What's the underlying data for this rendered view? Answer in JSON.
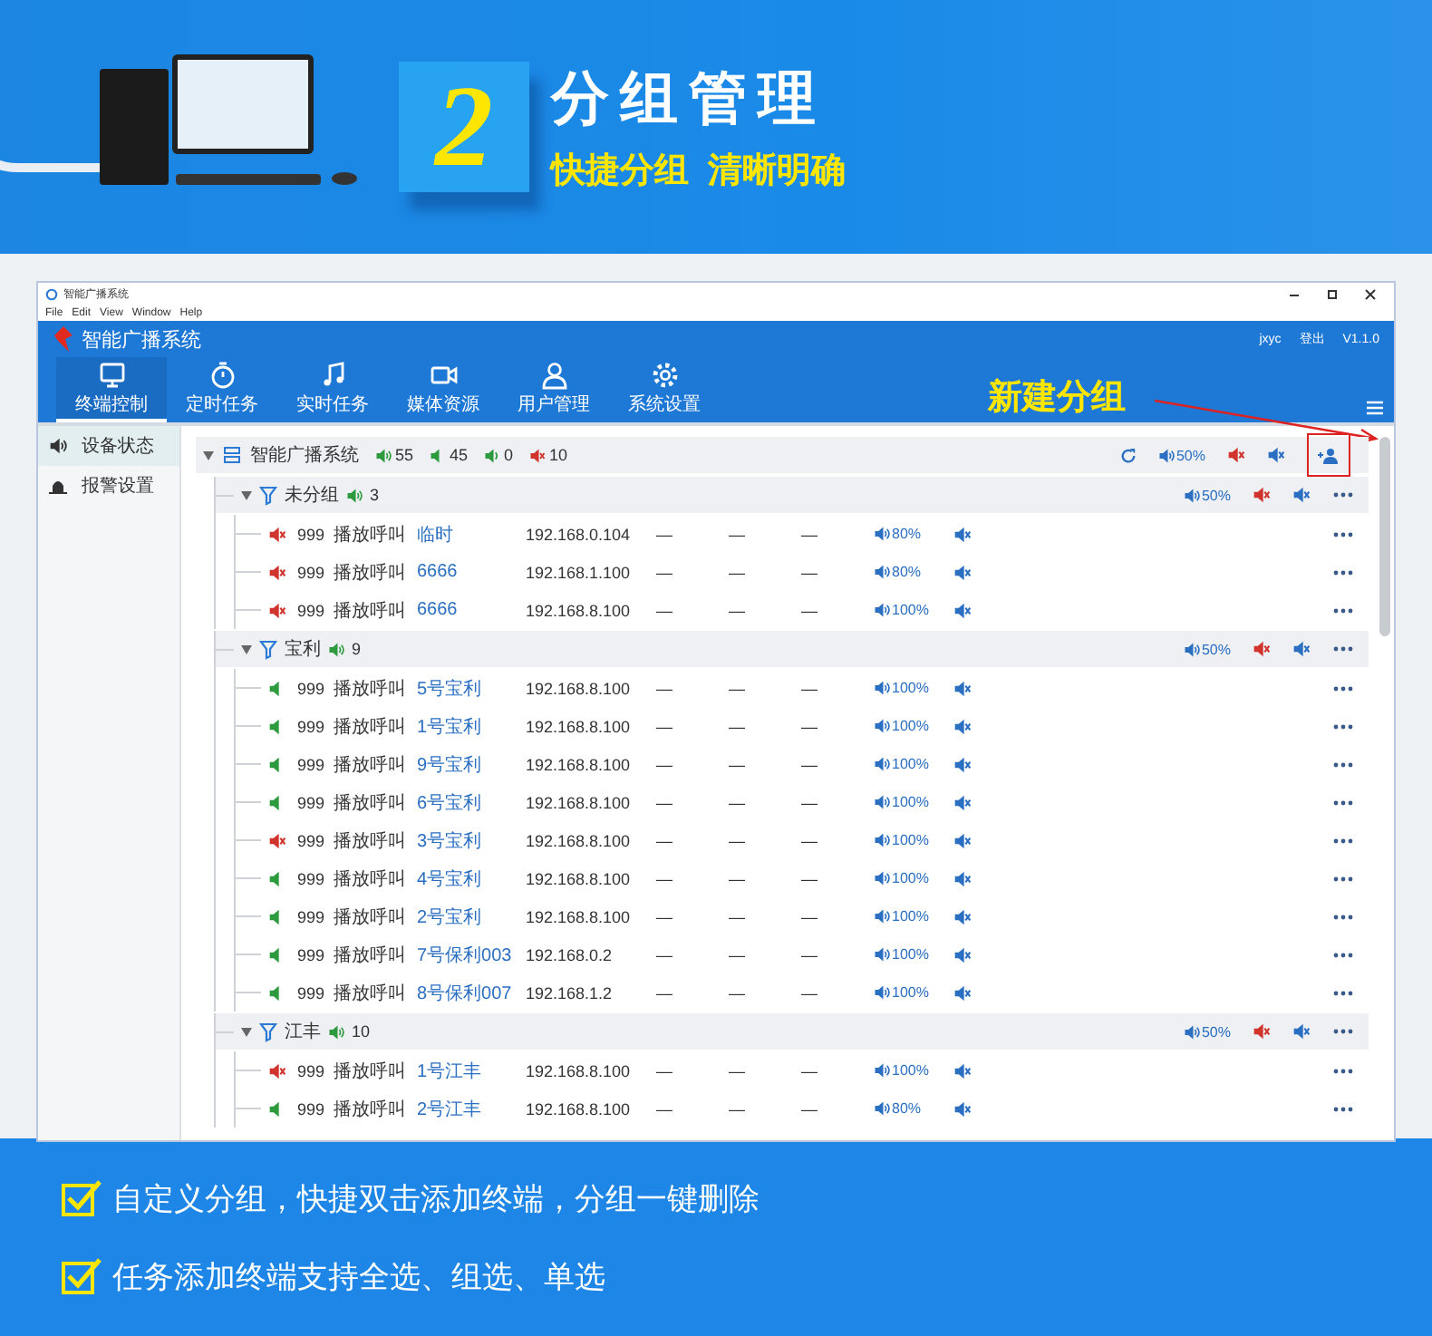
{
  "banner": {
    "number": "2",
    "title": "分组管理",
    "subtitle": "快捷分组  清晰明确"
  },
  "window": {
    "title": "智能广播系统",
    "menu": [
      "File",
      "Edit",
      "View",
      "Window",
      "Help"
    ],
    "app_title": "智能广播系统",
    "user": "jxyc",
    "logout": "登出",
    "version": "V1.1.0",
    "nav": [
      {
        "label": "终端控制",
        "selected": true
      },
      {
        "label": "定时任务",
        "selected": false
      },
      {
        "label": "实时任务",
        "selected": false
      },
      {
        "label": "媒体资源",
        "selected": false
      },
      {
        "label": "用户管理",
        "selected": false
      },
      {
        "label": "系统设置",
        "selected": false
      }
    ],
    "sidebar": [
      {
        "label": "设备状态",
        "selected": true
      },
      {
        "label": "报警设置",
        "selected": false
      }
    ],
    "annotation": "新建分组",
    "tree": {
      "name": "智能广播系统",
      "counts": [
        {
          "kind": "online",
          "value": "55"
        },
        {
          "kind": "idle",
          "value": "45"
        },
        {
          "kind": "playing",
          "value": "0"
        },
        {
          "kind": "muted",
          "value": "10"
        }
      ],
      "volume": "50%",
      "add_group_highlighted": true,
      "groups": [
        {
          "name": "未分组",
          "count": "3",
          "volume": "50%",
          "expanded": true,
          "children": [
            {
              "muted": true,
              "id": "999",
              "name": "播放呼叫",
              "label": "临时",
              "ip": "192.168.0.104",
              "cells": [
                "—",
                "—",
                "—"
              ],
              "volume": "80%"
            },
            {
              "muted": true,
              "id": "999",
              "name": "播放呼叫",
              "label": "6666",
              "ip": "192.168.1.100",
              "cells": [
                "—",
                "—",
                "—"
              ],
              "volume": "80%"
            },
            {
              "muted": true,
              "id": "999",
              "name": "播放呼叫",
              "label": "6666",
              "ip": "192.168.8.100",
              "cells": [
                "—",
                "—",
                "—"
              ],
              "volume": "100%"
            }
          ]
        },
        {
          "name": "宝利",
          "count": "9",
          "volume": "50%",
          "expanded": true,
          "children": [
            {
              "muted": false,
              "id": "999",
              "name": "播放呼叫",
              "label": "5号宝利",
              "ip": "192.168.8.100",
              "cells": [
                "—",
                "—",
                "—"
              ],
              "volume": "100%"
            },
            {
              "muted": false,
              "id": "999",
              "name": "播放呼叫",
              "label": "1号宝利",
              "ip": "192.168.8.100",
              "cells": [
                "—",
                "—",
                "—"
              ],
              "volume": "100%"
            },
            {
              "muted": false,
              "id": "999",
              "name": "播放呼叫",
              "label": "9号宝利",
              "ip": "192.168.8.100",
              "cells": [
                "—",
                "—",
                "—"
              ],
              "volume": "100%"
            },
            {
              "muted": false,
              "id": "999",
              "name": "播放呼叫",
              "label": "6号宝利",
              "ip": "192.168.8.100",
              "cells": [
                "—",
                "—",
                "—"
              ],
              "volume": "100%"
            },
            {
              "muted": true,
              "id": "999",
              "name": "播放呼叫",
              "label": "3号宝利",
              "ip": "192.168.8.100",
              "cells": [
                "—",
                "—",
                "—"
              ],
              "volume": "100%"
            },
            {
              "muted": false,
              "id": "999",
              "name": "播放呼叫",
              "label": "4号宝利",
              "ip": "192.168.8.100",
              "cells": [
                "—",
                "—",
                "—"
              ],
              "volume": "100%"
            },
            {
              "muted": false,
              "id": "999",
              "name": "播放呼叫",
              "label": "2号宝利",
              "ip": "192.168.8.100",
              "cells": [
                "—",
                "—",
                "—"
              ],
              "volume": "100%"
            },
            {
              "muted": false,
              "id": "999",
              "name": "播放呼叫",
              "label": "7号保利003",
              "ip": "192.168.0.2",
              "cells": [
                "—",
                "—",
                "—"
              ],
              "volume": "100%"
            },
            {
              "muted": false,
              "id": "999",
              "name": "播放呼叫",
              "label": "8号保利007",
              "ip": "192.168.1.2",
              "cells": [
                "—",
                "—",
                "—"
              ],
              "volume": "100%"
            }
          ]
        },
        {
          "name": "江丰",
          "count": "10",
          "volume": "50%",
          "expanded": true,
          "children": [
            {
              "muted": true,
              "id": "999",
              "name": "播放呼叫",
              "label": "1号江丰",
              "ip": "192.168.8.100",
              "cells": [
                "—",
                "—",
                "—"
              ],
              "volume": "100%"
            },
            {
              "muted": false,
              "id": "999",
              "name": "播放呼叫",
              "label": "2号江丰",
              "ip": "192.168.8.100",
              "cells": [
                "—",
                "—",
                "—"
              ],
              "volume": "80%"
            }
          ]
        }
      ]
    }
  },
  "features": [
    "自定义分组，快捷双击添加终端，分组一键删除",
    "任务添加终端支持全选、组选、单选"
  ]
}
